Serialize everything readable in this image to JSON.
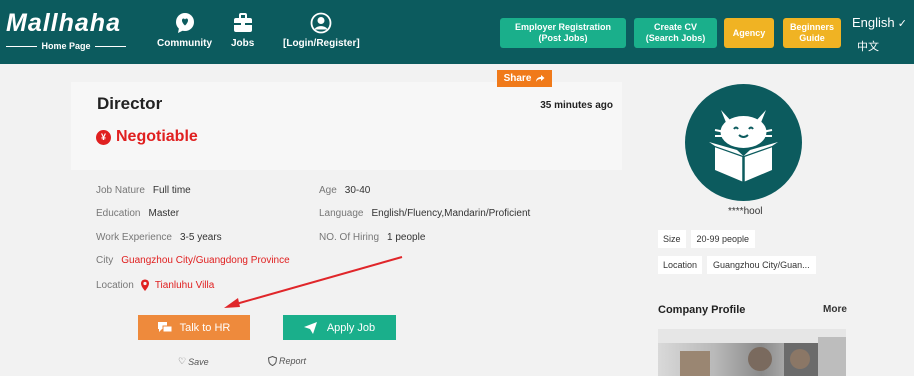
{
  "header": {
    "logo_text": "Mallhaha",
    "logo_sub": "Home Page",
    "nav": [
      {
        "label": "Community",
        "icon": "chat-bubble-icon"
      },
      {
        "label": "Jobs",
        "icon": "briefcase-icon"
      },
      {
        "label": "[Login/Register]",
        "icon": "user-icon"
      }
    ],
    "buttons": {
      "employer_line1": "Employer Registration",
      "employer_line2": "(Post Jobs)",
      "cv_line1": "Create CV",
      "cv_line2": "(Search Jobs)",
      "agency": "Agency",
      "beginners_line1": "Beginners",
      "beginners_line2": "Guide"
    },
    "lang_current": "English",
    "lang_other": "中文"
  },
  "job": {
    "title": "Director",
    "posted": "35 minutes ago",
    "salary": "Negotiable",
    "share": "Share",
    "details": {
      "job_nature_k": "Job Nature",
      "job_nature_v": "Full time",
      "age_k": "Age",
      "age_v": "30-40",
      "education_k": "Education",
      "education_v": "Master",
      "language_k": "Language",
      "language_v": "English/Fluency,Mandarin/Proficient",
      "experience_k": "Work Experience",
      "experience_v": "3-5 years",
      "hiring_k": "NO. Of Hiring",
      "hiring_v": "1 people",
      "city_k": "City",
      "city_v": "Guangzhou City/Guangdong Province",
      "location_k": "Location",
      "location_v": "Tianluhu Villa"
    },
    "talk_hr": "Talk to HR",
    "apply": "Apply Job",
    "save": "Save",
    "report": "Report"
  },
  "company": {
    "name": "****hool",
    "size_k": "Size",
    "size_v": "20-99 people",
    "location_k": "Location",
    "location_v": "Guangzhou City/Guan...",
    "profile_title": "Company Profile",
    "more": "More"
  },
  "colors": {
    "header": "#0c5b5e",
    "green": "#1aaf8b",
    "yellow": "#f0b323",
    "orange": "#ee8a3c",
    "red": "#e02020"
  }
}
